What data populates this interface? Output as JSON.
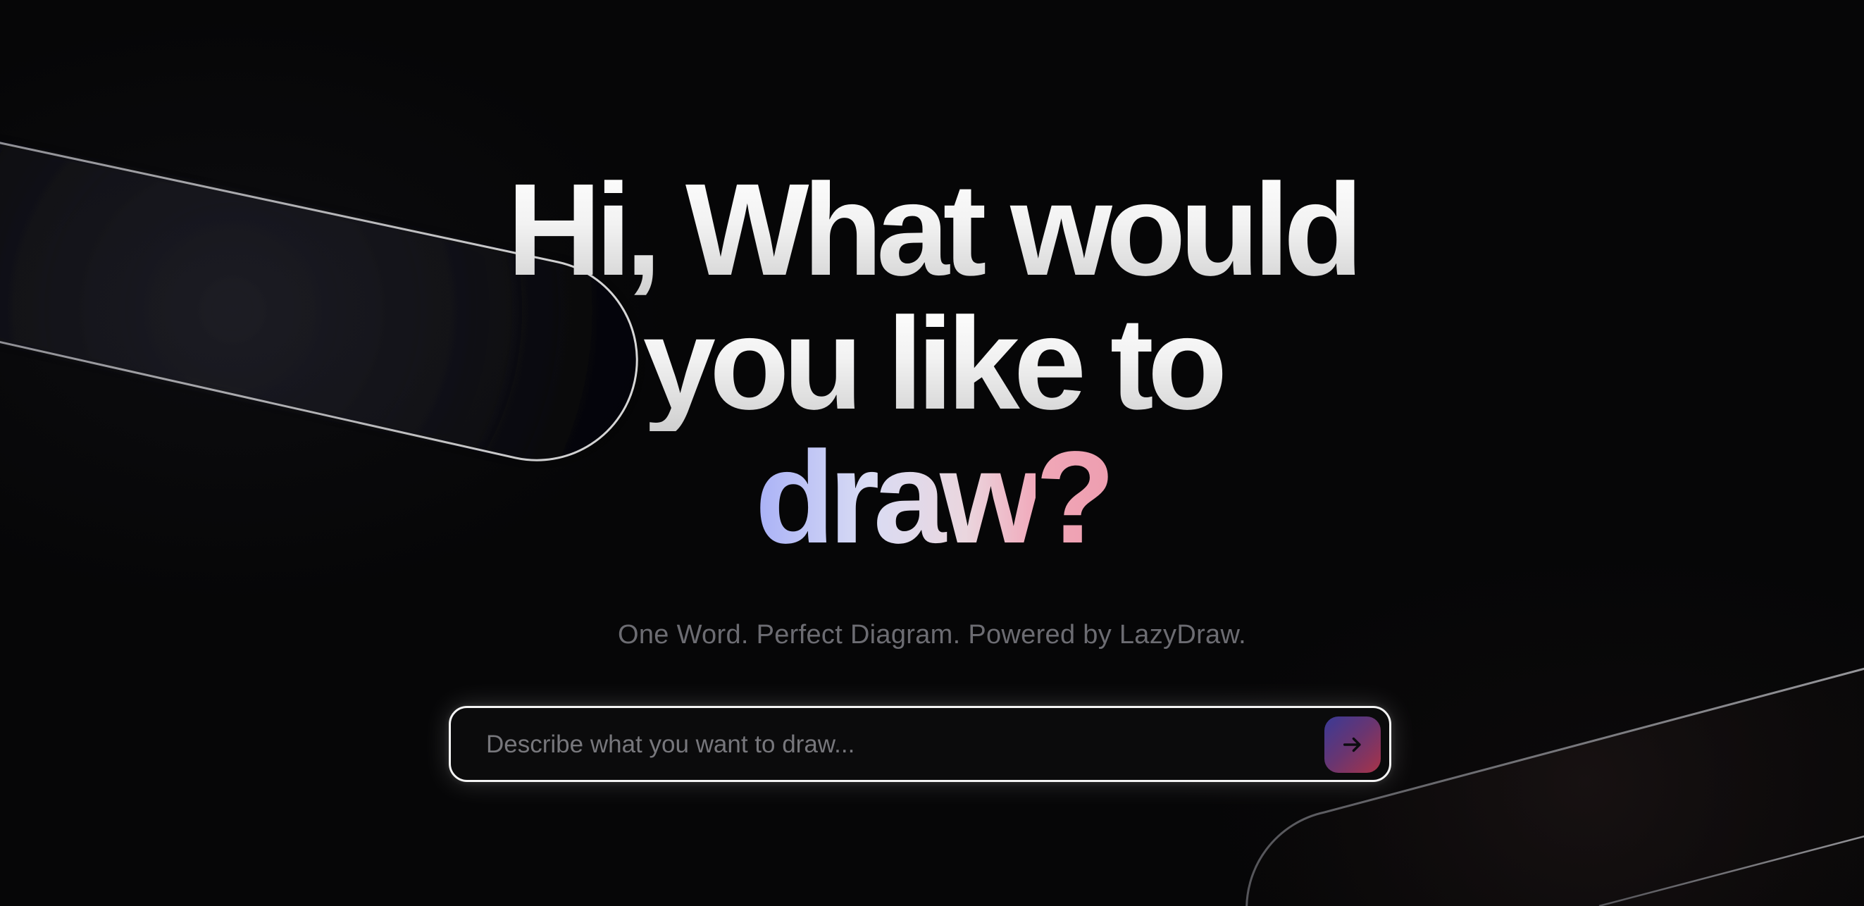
{
  "hero": {
    "line1": "Hi, What would",
    "line2": "you like to",
    "line3_word": "draw",
    "line3_punct": "?"
  },
  "tagline": "One Word. Perfect Diagram. Powered by LazyDraw.",
  "prompt": {
    "placeholder": "Describe what you want to draw...",
    "value": ""
  },
  "send_button": {
    "icon": "arrow-right-icon",
    "gradient": [
      "#3a3a96",
      "#a83448"
    ]
  },
  "colors": {
    "background": "#060607",
    "headline": "#e8e8e8",
    "accent_blue": "#a9b1f6",
    "accent_pink": "#f0a8b8",
    "tagline": "#6c6c72"
  }
}
